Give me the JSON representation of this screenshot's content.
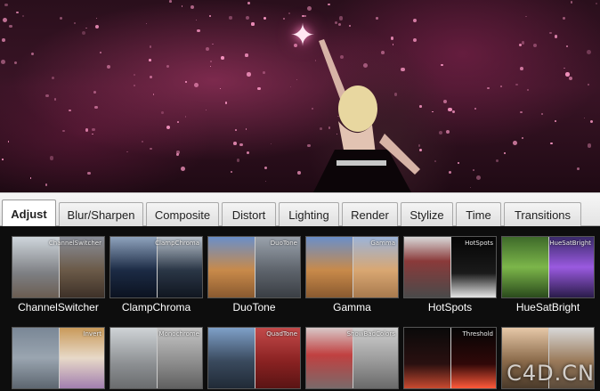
{
  "tabs": [
    {
      "label": "Adjust"
    },
    {
      "label": "Blur/Sharpen"
    },
    {
      "label": "Composite"
    },
    {
      "label": "Distort"
    },
    {
      "label": "Lighting"
    },
    {
      "label": "Render"
    },
    {
      "label": "Stylize"
    },
    {
      "label": "Time"
    },
    {
      "label": "Transitions"
    }
  ],
  "active_tab": "Adjust",
  "effects_row1": [
    {
      "label": "ChannelSwitcher",
      "tag": "ChannelSwitcher"
    },
    {
      "label": "ClampChroma",
      "tag": "ClampChroma"
    },
    {
      "label": "DuoTone",
      "tag": "DuoTone"
    },
    {
      "label": "Gamma",
      "tag": "Gamma"
    },
    {
      "label": "HotSpots",
      "tag": "HotSpots"
    },
    {
      "label": "HueSatBright",
      "tag": "HueSatBright"
    }
  ],
  "effects_row2": [
    {
      "tag": "Invert"
    },
    {
      "tag": "Monochrome"
    },
    {
      "tag": "QuadTone"
    },
    {
      "tag": "ShowBadColors"
    },
    {
      "tag": "Threshold"
    },
    {
      "tag": ""
    }
  ],
  "watermark": "C4D.CN",
  "colors": {
    "accent": "#ff5fa8",
    "grid_bg": "#0d0d0d",
    "tab_bg": "#e4e4e4"
  }
}
